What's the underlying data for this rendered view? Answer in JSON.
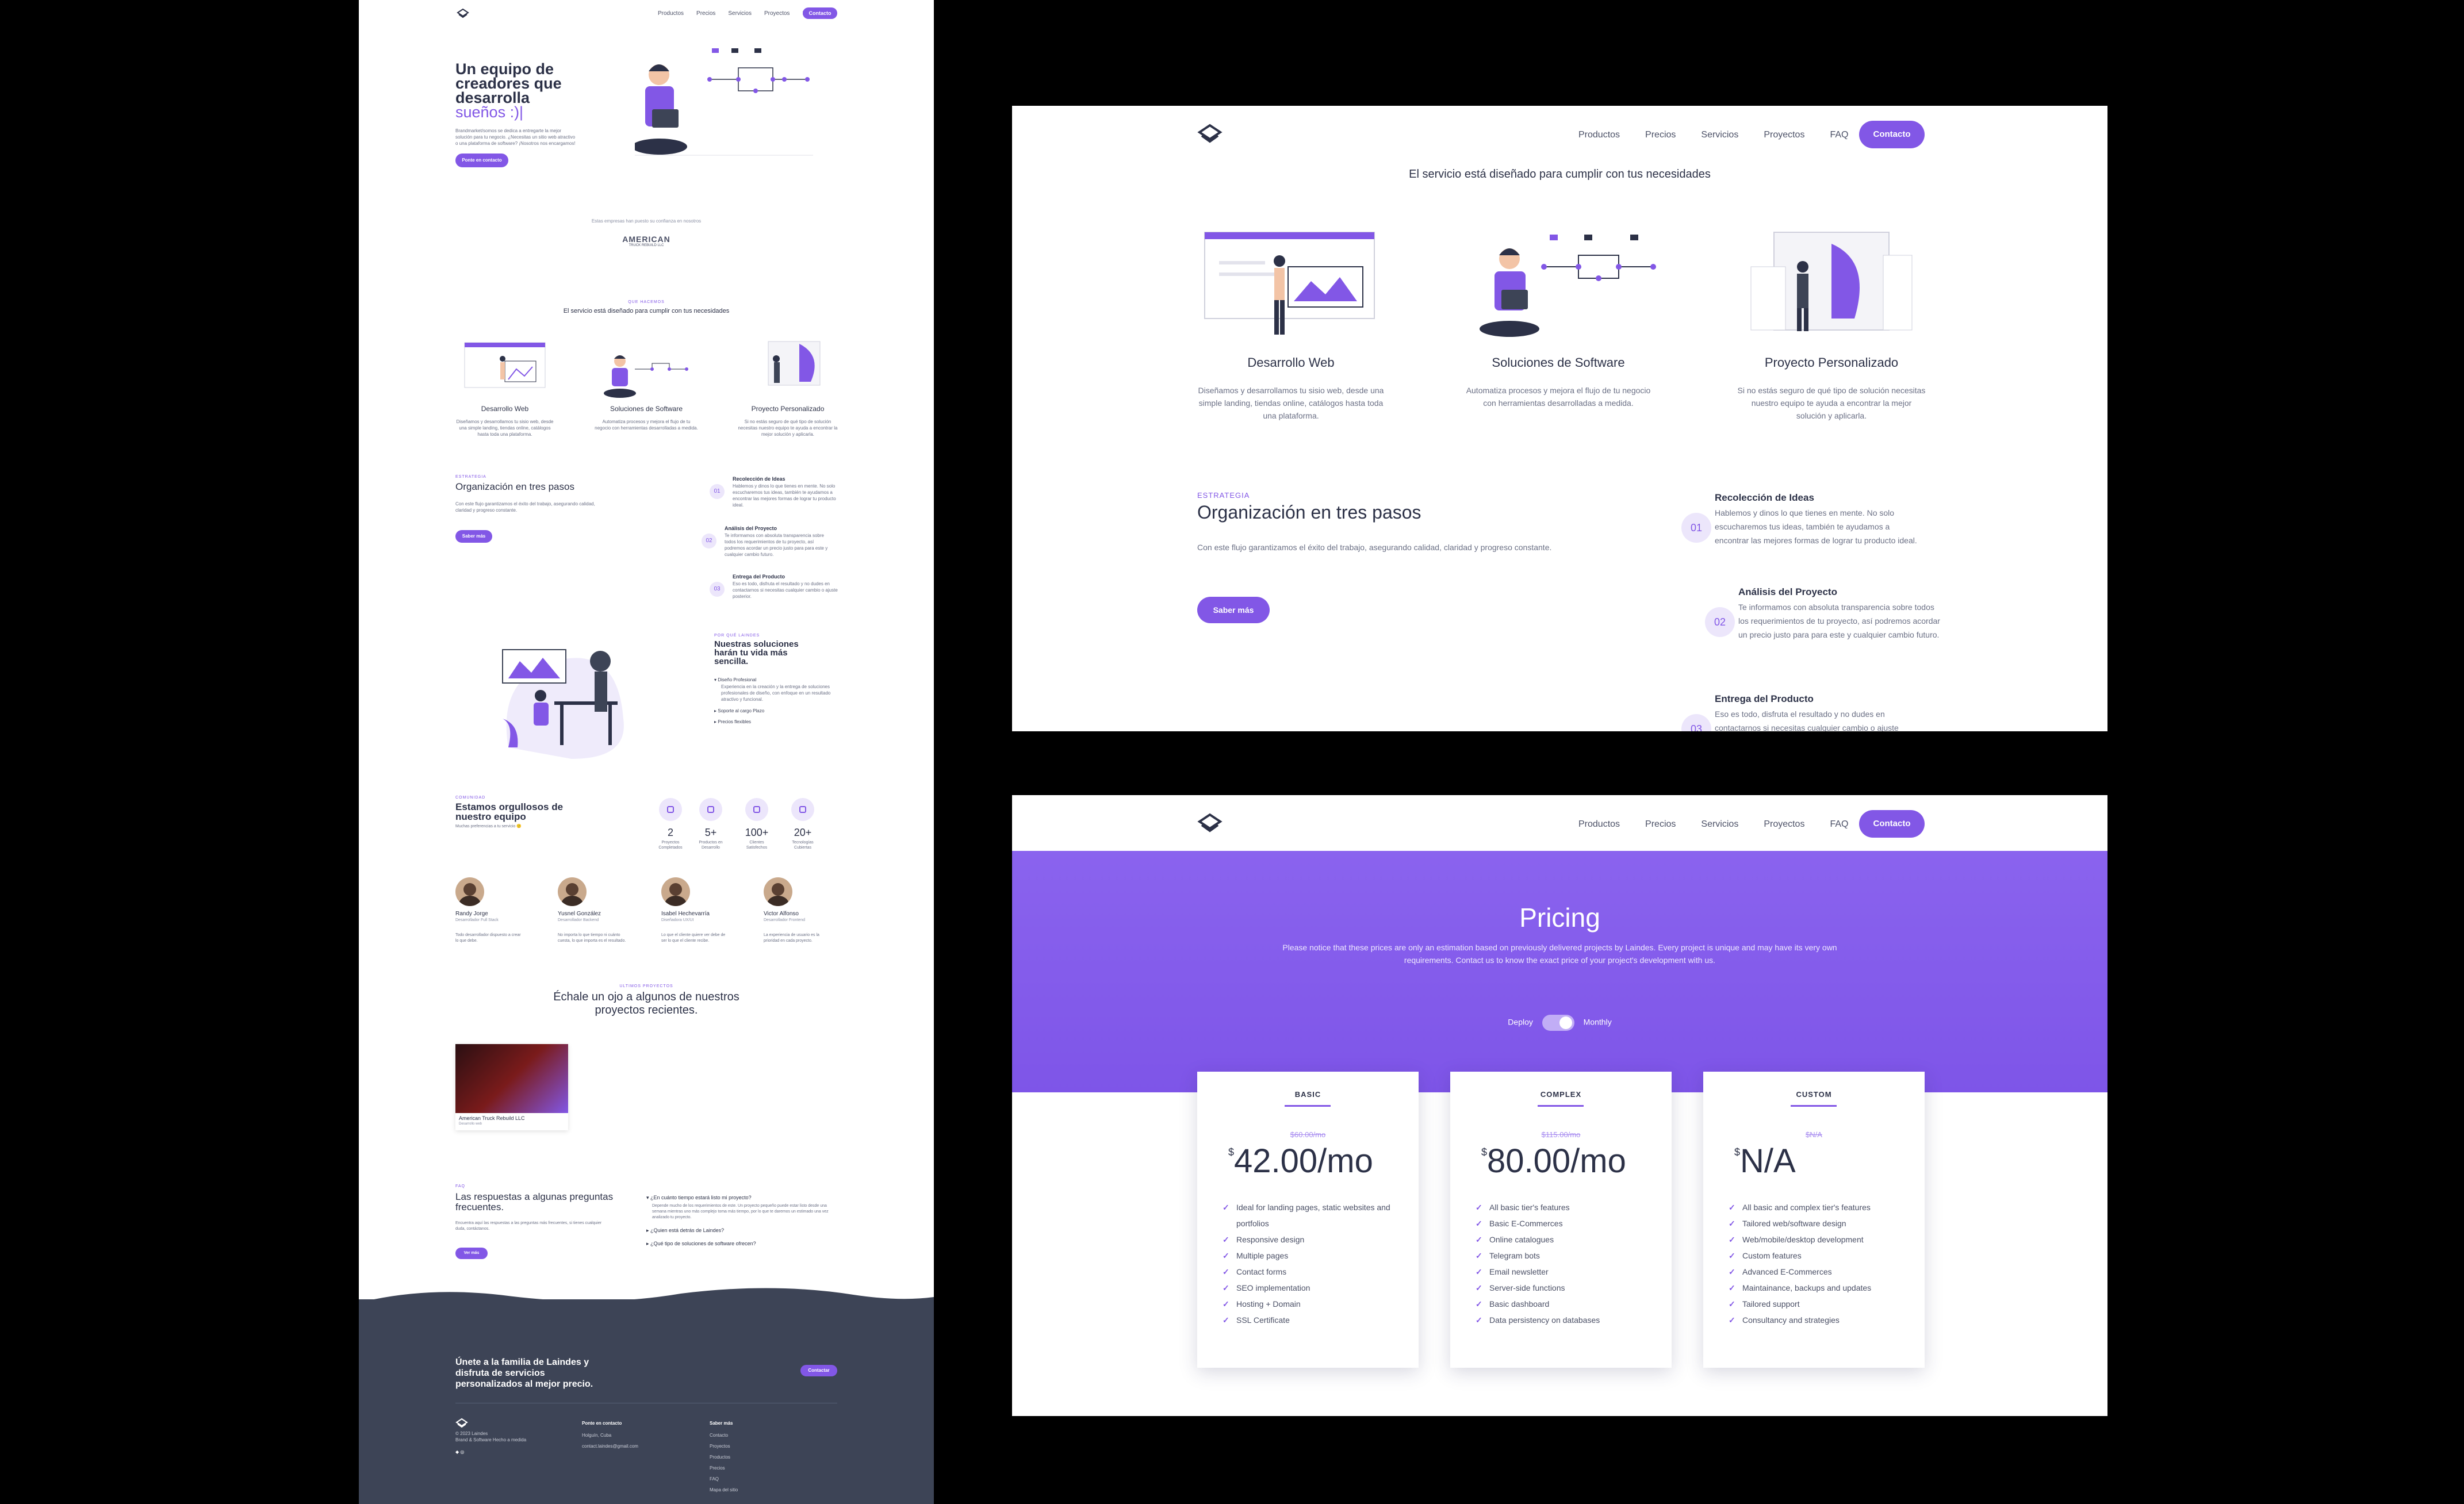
{
  "nav": {
    "items": [
      "Productos",
      "Precios",
      "Servicios",
      "Proyectos",
      "FAQ"
    ],
    "cta": "Contacto"
  },
  "hero": {
    "title_lines": [
      "Un equipo de",
      "creadores que",
      "desarrolla"
    ],
    "title_accent": "sueños :)|",
    "paragraph": "Brandmarket/somos se dedica a entregarte la mejor solución para tu negocio. ¿Necesitas un sitio web atractivo o una plataforma de software? ¡Nosotros nos encargamos!",
    "button": "Ponte en contacto"
  },
  "trust": {
    "text": "Estas empresas han puesto su confianza en nosotros",
    "logo_text": "AMERICAN",
    "logo_sub": "TRUCK REBUILD LLC"
  },
  "services": {
    "eyebrow": "QUE HACEMOS",
    "title": "El servicio está diseñado para cumplir con tus necesidades",
    "items": [
      {
        "title": "Desarrollo Web",
        "desc": "Diseñamos y desarrollamos tu sisio web, desde una simple landing, tiendas online, catálogos hasta toda una plataforma."
      },
      {
        "title": "Soluciones de Software",
        "desc": "Automatiza procesos y mejora el flujo de tu negocio con herramientas desarrolladas a medida."
      },
      {
        "title": "Proyecto Personalizado",
        "desc": "Si no estás seguro de qué tipo de solución necesitas nuestro equipo te ayuda a encontrar la mejor solución y aplicarla."
      }
    ]
  },
  "strategy": {
    "eyebrow": "ESTRATEGIA",
    "title": "Organización en tres pasos",
    "text": "Con este flujo garantizamos el éxito del trabajo, asegurando calidad, claridad y progreso constante.",
    "button": "Saber más",
    "steps": [
      {
        "num": "01",
        "title": "Recolección de Ideas",
        "desc": "Hablemos y dinos lo que tienes en mente. No solo escucharemos tus ideas, también te ayudamos a encontrar las mejores formas de lograr tu producto ideal."
      },
      {
        "num": "02",
        "title": "Análisis del Proyecto",
        "desc": "Te informamos con absoluta transparencia sobre todos los requerimientos de tu proyecto, así podremos acordar un precio justo para para este y cualquier cambio futuro."
      },
      {
        "num": "03",
        "title": "Entrega del Producto",
        "desc": "Eso es todo, disfruta el resultado y no dudes en contactarnos si necesitas cualquier cambio o ajuste posterior."
      }
    ]
  },
  "benefits": {
    "eyebrow": "POR QUÉ LAINDES",
    "title_lines": [
      "Nuestras soluciones",
      "harán tu vida más",
      "sencilla."
    ],
    "items": [
      {
        "title": "Diseño Profesional",
        "desc": "Experiencia en la creación y la entrega de soluciones profesionales de diseño, con enfoque en un resultado atractivo y funcional."
      },
      {
        "title": "Soporte al cargo Plazo",
        "desc": ""
      },
      {
        "title": "Precios flexibles",
        "desc": ""
      }
    ]
  },
  "team": {
    "eyebrow": "COMUNIDAD",
    "title_lines": [
      "Estamos orgullosos de",
      "nuestro equipo"
    ],
    "subtitle": "Muchas preferencias a tu servicio 🙂",
    "stats": [
      {
        "value": "2",
        "label": "Proyectos Completados"
      },
      {
        "value": "5+",
        "label": "Productos en Desarrollo"
      },
      {
        "value": "100+",
        "label": "Clientes Satisfechos"
      },
      {
        "value": "20+",
        "label": "Tecnologías Cubiertas"
      }
    ],
    "members": [
      {
        "name": "Randy Jorge",
        "role": "Desarrollador Full Stack",
        "quote": "Todo desarrollador dispuesto a crear lo que debe."
      },
      {
        "name": "Yusnel González",
        "role": "Desarrollador Backend",
        "quote": "No importa lo que tiempo ni cuánto cuesta, lo que importa es el resultado."
      },
      {
        "name": "Isabel Hechevarría",
        "role": "Diseñadora UX/UI",
        "quote": "Lo que el cliente quiere ver debe de ser lo que el cliente recibe."
      },
      {
        "name": "Victor Alfonso",
        "role": "Desarrollador Frontend",
        "quote": "La experiencia de usuario es la prioridad en cada proyecto."
      }
    ]
  },
  "projects": {
    "eyebrow": "ULTIMOS PROYECTOS",
    "title_lines": [
      "Échale un ojo a algunos de nuestros",
      "proyectos recientes."
    ],
    "item": {
      "name": "American Truck Rebuild LLC",
      "tag": "Desarrollo web"
    }
  },
  "faq": {
    "eyebrow": "FAQ",
    "title_lines": [
      "Las respuestas a algunas preguntas",
      "frecuentes."
    ],
    "text": "Encuentra aquí las respuestas a las preguntas más frecuentes, si tienes cualquier duda, contáctanos.",
    "button": "Ver más",
    "items": [
      {
        "q": "¿En cuánto tiempo estará listo mi proyecto?",
        "a": "Depende mucho de los requerimientos de este. Un proyecto pequeño puede estar listo desde una semana mientras uno más complejo toma más tiempo, por lo que te daremos un estimado una vez analizado tu proyecto."
      },
      {
        "q": "¿Quien está detrás de Laindes?",
        "a": ""
      },
      {
        "q": "¿Qué tipo de soluciones de software ofrecen?",
        "a": ""
      }
    ]
  },
  "footer": {
    "cta_lines": [
      "Únete a la familia de Laindes y",
      "disfruta de servicios",
      "personalizados al mejor precio."
    ],
    "cta_button": "Contactar",
    "copyright": "© 2023 Laindes",
    "tagline": "Brand & Software Hecho a medida",
    "contact_title": "Ponte en contacto",
    "contact_lines": [
      "Holguín, Cuba",
      "contact.laindes@gmail.com"
    ],
    "links_title": "Saber más",
    "links": [
      "Contacto",
      "Proyectos",
      "Productos",
      "Precios",
      "FAQ",
      "Mapa del sitio"
    ]
  },
  "pricing": {
    "title": "Pricing",
    "note": "Please notice that these prices are only an estimation based on previously delivered projects by Laindes. Every project is unique and may have its very own requirements. Contact us to know the exact price of your project's development with us.",
    "toggle_left": "Deploy",
    "toggle_right": "Monthly",
    "plans": [
      {
        "name": "BASIC",
        "old": "$60.00/mo",
        "currency": "$",
        "price": "42.00/mo",
        "features": [
          "Ideal for landing pages, static websites and portfolios",
          "Responsive design",
          "Multiple pages",
          "Contact forms",
          "SEO implementation",
          "Hosting + Domain",
          "SSL Certificate"
        ]
      },
      {
        "name": "COMPLEX",
        "old": "$115.00/mo",
        "currency": "$",
        "price": "80.00/mo",
        "features": [
          "All basic tier's features",
          "Basic E-Commerces",
          "Online catalogues",
          "Telegram bots",
          "Email newsletter",
          "Server-side functions",
          "Basic dashboard",
          "Data persistency on databases"
        ]
      },
      {
        "name": "CUSTOM",
        "old": "$N/A",
        "currency": "$",
        "price": "N/A",
        "features": [
          "All basic and complex tier's features",
          "Tailored web/software design",
          "Web/mobile/desktop development",
          "Custom features",
          "Advanced E-Commerces",
          "Maintainance, backups and updates",
          "Tailored support",
          "Consultancy and strategies"
        ]
      }
    ]
  },
  "colors": {
    "accent": "#8257e6",
    "dark": "#3d4456",
    "text": "#2c3147"
  }
}
